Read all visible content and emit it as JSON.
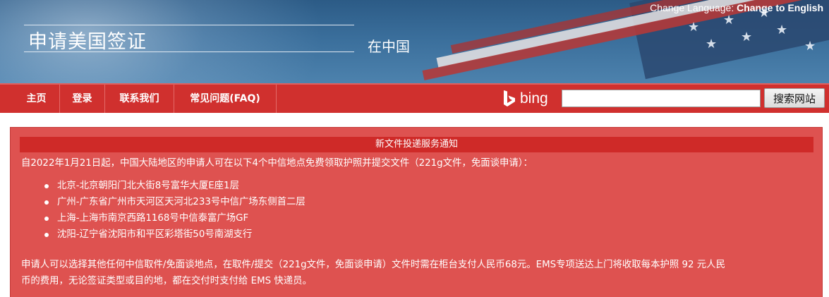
{
  "header": {
    "language_label": "Change Language:",
    "language_link": "Change to English",
    "title": "申请美国签证",
    "subtitle": "在中国"
  },
  "nav": {
    "items": [
      {
        "label": "主页"
      },
      {
        "label": "登录"
      },
      {
        "label": "联系我们"
      },
      {
        "label": "常见问题(FAQ)"
      }
    ]
  },
  "search": {
    "brand": "bing",
    "value": "",
    "button_label": "搜索网站"
  },
  "notice": {
    "title": "新文件投递服务通知",
    "intro": "自2022年1月21日起，中国大陆地区的申请人可在以下4个中信地点免费领取护照并提交文件（221g文件，免面谈申请）：",
    "locations": [
      "北京-北京朝阳门北大街8号富华大厦E座1层",
      "广州-广东省广州市天河区天河北233号中信广场东侧首二层",
      "上海-上海市南京西路1168号中信泰富广场GF",
      "沈阳-辽宁省沈阳市和平区彩塔街50号南湖支行"
    ],
    "footer_line1": "申请人可以选择其他任何中信取件/免面谈地点，在取件/提交（221g文件，免面谈申请）文件时需在柜台支付人民币68元。EMS专项送达上门将收取每本护照 92 元人民",
    "footer_line2": "币的费用，无论签证类型或目的地，都在交付时支付给 EMS 快递员。"
  },
  "colors": {
    "nav_red": "#d0302e",
    "notice_bg": "#de5250",
    "notice_header": "#cf2a28",
    "banner_blue": "#3a6e9b"
  }
}
